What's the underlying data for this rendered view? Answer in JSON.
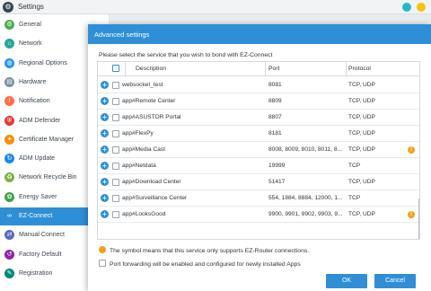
{
  "app": {
    "title": "Settings"
  },
  "sidebar": {
    "items": [
      {
        "label": "General",
        "icon": "general-icon",
        "color": "#4caf50"
      },
      {
        "label": "Network",
        "icon": "network-icon",
        "color": "#26a69a"
      },
      {
        "label": "Regional Options",
        "icon": "globe-icon",
        "color": "#2196f3"
      },
      {
        "label": "Hardware",
        "icon": "hardware-icon",
        "color": "#78909c"
      },
      {
        "label": "Notification",
        "icon": "notification-icon",
        "color": "#ff7043"
      },
      {
        "label": "ADM Defender",
        "icon": "shield-icon",
        "color": "#e53935"
      },
      {
        "label": "Certificate Manager",
        "icon": "certificate-icon",
        "color": "#fb8c00"
      },
      {
        "label": "ADM Update",
        "icon": "update-icon",
        "color": "#1e88e5"
      },
      {
        "label": "Network Recycle Bin",
        "icon": "recycle-bin-icon",
        "color": "#7cb342"
      },
      {
        "label": "Energy Saver",
        "icon": "leaf-icon",
        "color": "#43a047"
      },
      {
        "label": "EZ-Connect",
        "icon": "ez-connect-icon",
        "color": "#ffffff"
      },
      {
        "label": "Manual Connect",
        "icon": "manual-connect-icon",
        "color": "#5c6bc0"
      },
      {
        "label": "Factory Default",
        "icon": "reset-icon",
        "color": "#8e24aa"
      },
      {
        "label": "Registration",
        "icon": "registration-icon",
        "color": "#00897b"
      }
    ],
    "active_index": 10
  },
  "dialog": {
    "title": "Advanced settings",
    "instruction": "Please select the service that you wish to bond with EZ-Connect",
    "columns": {
      "description": "Description",
      "port": "Port",
      "protocol": "Protocol"
    },
    "rows": [
      {
        "name": "websocket_test",
        "port": "8081",
        "protocol": "TCP, UDP",
        "warning": false
      },
      {
        "name": "app#Remote Center",
        "port": "8809",
        "protocol": "TCP, UDP",
        "warning": false
      },
      {
        "name": "app#ASUSTOR Portal",
        "port": "8807",
        "protocol": "TCP, UDP",
        "warning": false
      },
      {
        "name": "app#FlexPy",
        "port": "8181",
        "protocol": "TCP, UDP",
        "warning": false
      },
      {
        "name": "app#Media Cast",
        "port": "8008, 8009, 8010, 8011, 8...",
        "protocol": "TCP, UDP",
        "warning": true
      },
      {
        "name": "app#Netdata",
        "port": "19999",
        "protocol": "TCP",
        "warning": false
      },
      {
        "name": "app#Download Center",
        "port": "51417",
        "protocol": "TCP, UDP",
        "warning": false
      },
      {
        "name": "app#Surveillance Center",
        "port": "554, 1884, 8884, 12000, 1...",
        "protocol": "TCP",
        "warning": false
      },
      {
        "name": "app#LooksGood",
        "port": "9900, 9901, 9902, 9903, 9...",
        "protocol": "TCP, UDP",
        "warning": true
      }
    ],
    "note": "The symbol means that this service only supports EZ-Router connections.",
    "port_forwarding_label": "Port forwarding will be enabled and configured for newly installed Apps",
    "ok_label": "OK",
    "cancel_label": "Cancel"
  },
  "colors": {
    "accent": "#2f8fd6",
    "warning": "#f0a21b"
  }
}
